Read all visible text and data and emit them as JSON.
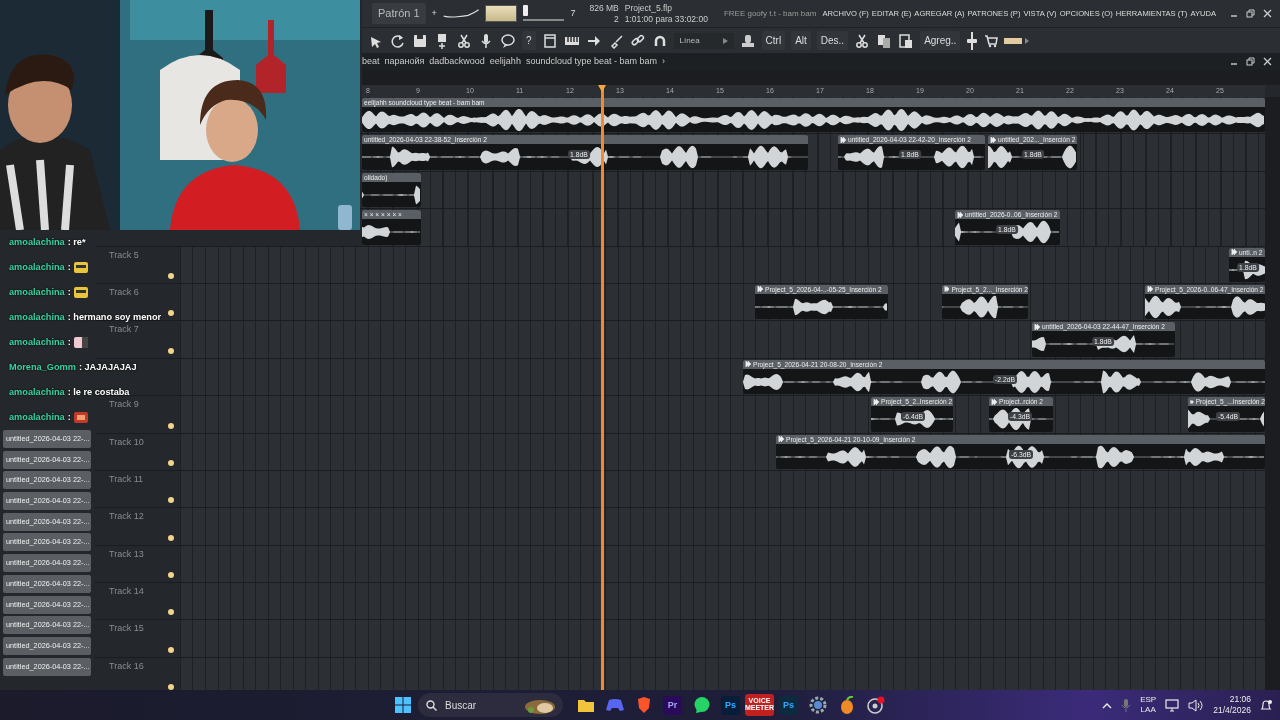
{
  "toolbar": {
    "pattern": "Patrón 1",
    "add": "+",
    "master_slider": {
      "level": 0
    },
    "slider_value": "7",
    "memory": "826 MB",
    "cpu": "2",
    "project": "Project_5.flp",
    "time": "1:01:00 para 33:02:00",
    "hint": "FREE goofy t.t - bam bam"
  },
  "menu": [
    "ARCHIVO (F)",
    "EDITAR (E)",
    "AGREGAR (A)",
    "PATRONES (P)",
    "VISTA (V)",
    "OPCIONES (O)",
    "HERRAMIENTAS (T)",
    "AYUDA"
  ],
  "tools": {
    "help": "?",
    "snap": "Línea",
    "modifiers": [
      "Ctrl",
      "Alt",
      "Des.."
    ],
    "add": "Agreg.."
  },
  "breadcrumb": [
    "beat",
    "паранойя",
    "dadbackwood",
    "eelijahh",
    "soundcloud type beat - bam bam"
  ],
  "breadcrumb_arrow": "›",
  "ruler": [
    "8",
    "9",
    "10",
    "11",
    "12",
    "13",
    "14",
    "15",
    "16",
    "17",
    "18",
    "19",
    "20",
    "21",
    "22",
    "23",
    "24",
    "25"
  ],
  "tracks": [
    {
      "clips": [
        {
          "label": "eelijahh  soundcloud type beat - bam bam"
        }
      ]
    },
    {
      "clips": [
        {
          "label": "untitled_2026-04-03 22-38-52_Inserción 2",
          "gain": "1.8dB"
        },
        {
          "label": "untitled_2026-04-03 22-42-20_Inserción 2",
          "gain": "1.8dB"
        },
        {
          "label": "untitled_202..._Inserción 2",
          "gain": "1.8dB"
        }
      ]
    },
    {
      "clips": [
        {
          "label": "olidado)"
        }
      ]
    },
    {
      "clips": [
        {
          "label": "× × × × × × ×"
        },
        {
          "label": "untitled_2026-0..06_Inserción 2",
          "gain": "1.8dB"
        }
      ]
    },
    {
      "label": "Track 5",
      "clips": [
        {
          "label": "unti..n 2",
          "gain": "1.8dB"
        }
      ]
    },
    {
      "label": "Track 6",
      "clips": [
        {
          "label": "Project_5_2026-04-..-05-25_Inserción 2"
        },
        {
          "label": "Project_5_2..._Inserción 2"
        },
        {
          "label": "Project_5_2026-0..06-47_Inserción 2"
        }
      ]
    },
    {
      "label": "Track 7",
      "clips": [
        {
          "label": "untitled_2026-04-03 22-44-47_Inserción 2",
          "gain": "1.8dB"
        }
      ]
    },
    {
      "clips": [
        {
          "label": "Project_5_2026-04-21 20-08-20_Inserción 2",
          "gain": "-2.2dB"
        }
      ]
    },
    {
      "label": "Track 9",
      "clips": [
        {
          "label": "Project_5_2..Inserción 2",
          "gain": "-6.4dB"
        },
        {
          "label": "Project..rción 2",
          "gain": "-4.3dB"
        },
        {
          "label": "Project_5_...Inserción 2",
          "gain": "-5.4dB"
        }
      ]
    },
    {
      "label": "Track 10",
      "clips": [
        {
          "label": "Project_5_2026-04-21 20-10-09_Inserción 2",
          "gain": "-6.3dB"
        }
      ]
    },
    {
      "label": "Track 11"
    },
    {
      "label": "Track 12"
    },
    {
      "label": "Track 13"
    },
    {
      "label": "Track 14"
    },
    {
      "label": "Track 15"
    },
    {
      "label": "Track 16"
    }
  ],
  "picker": [
    "untitled_2026-04-03 22-...",
    "untitled_2026-04-03 22-...",
    "untitled_2026-04-03 22-...",
    "untitled_2026-04-03 22-...",
    "untitled_2026-04-03 22-...",
    "untitled_2026-04-03 22-...",
    "untitled_2026-04-03 22-...",
    "untitled_2026-04-03 22-...",
    "untitled_2026-04-03 22-...",
    "untitled_2026-04-03 22-...",
    "untitled_2026-04-03 22-...",
    "untitled_2026-04-03 22-..."
  ],
  "chat": [
    {
      "user": "amoalachina",
      "kind": "text",
      "text": ": re*"
    },
    {
      "user": "amoalachina",
      "kind": "emote",
      "text": ":"
    },
    {
      "user": "amoalachina",
      "kind": "emote",
      "text": ":"
    },
    {
      "user": "amoalachina",
      "kind": "text",
      "text": ": hermano soy menor"
    },
    {
      "user": "amoalachina",
      "kind": "sticker",
      "text": ":"
    },
    {
      "user": "Morena_Gomm",
      "kind": "text",
      "text": ": JAJAJAJAJ"
    },
    {
      "user": "amoalachina",
      "kind": "text",
      "text": ": le re costaba"
    },
    {
      "user": "amoalachina",
      "kind": "badge",
      "text": ":"
    }
  ],
  "taskbar": {
    "search": "Buscar",
    "app_labels": [
      "Pr",
      "Ps",
      "VOICE MEETER",
      "Ps"
    ],
    "language": "ESP",
    "layout": "LAA",
    "time": "21:06",
    "date": "21/4/2026"
  }
}
